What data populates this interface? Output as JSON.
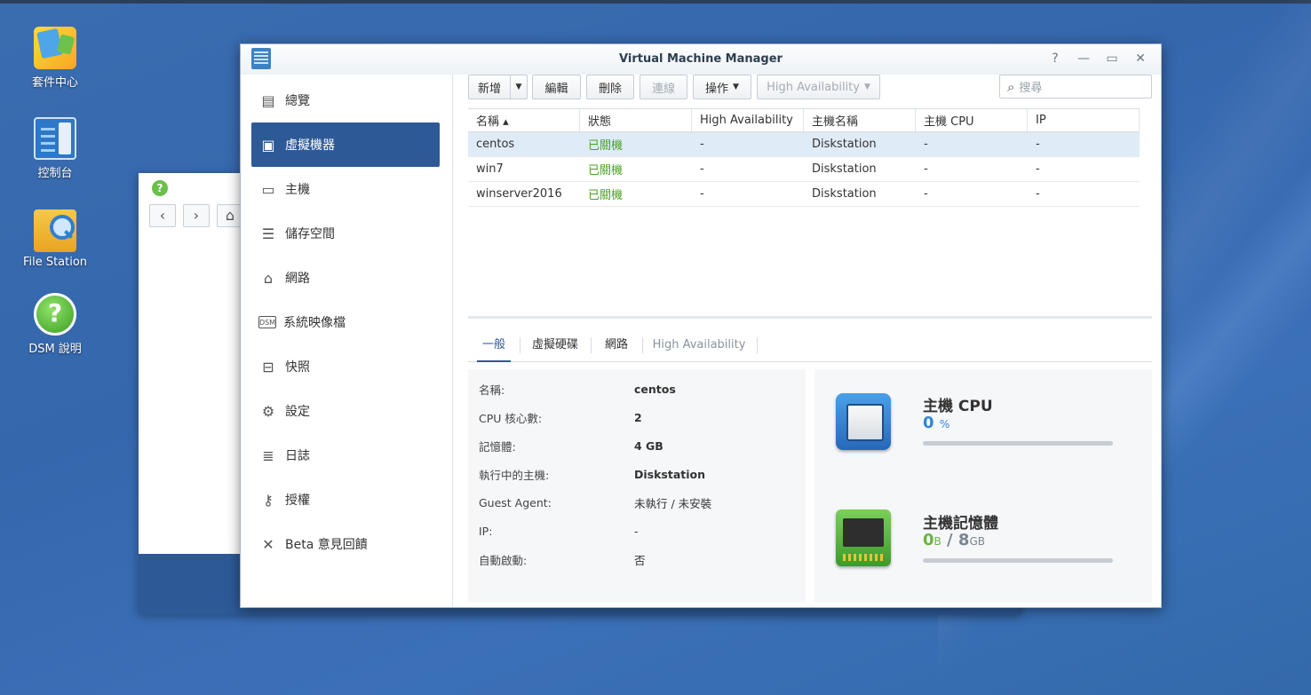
{
  "desktop": {
    "icons": [
      {
        "label": "套件中心",
        "icon": "package-center-icon"
      },
      {
        "label": "控制台",
        "icon": "control-panel-icon"
      },
      {
        "label": "File Station",
        "icon": "file-station-icon"
      },
      {
        "label": "DSM 說明",
        "icon": "dsm-help-icon"
      }
    ]
  },
  "bg_window": {
    "help_glyph": "?"
  },
  "window": {
    "title": "Virtual Machine Manager",
    "controls": {
      "help": "?",
      "minimize": "—",
      "maximize": "▭",
      "close": "✕"
    }
  },
  "sidebar": {
    "items": [
      {
        "label": "總覽",
        "icon": "overview-icon",
        "active": false
      },
      {
        "label": "虛擬機器",
        "icon": "virtual-machine-icon",
        "active": true
      },
      {
        "label": "主機",
        "icon": "host-icon",
        "active": false
      },
      {
        "label": "儲存空間",
        "icon": "storage-icon",
        "active": false
      },
      {
        "label": "網路",
        "icon": "network-icon",
        "active": false
      },
      {
        "label": "系統映像檔",
        "icon": "image-icon",
        "active": false
      },
      {
        "label": "快照",
        "icon": "snapshot-icon",
        "active": false
      },
      {
        "label": "設定",
        "icon": "settings-gear-icon",
        "active": false
      },
      {
        "label": "日誌",
        "icon": "log-icon",
        "active": false
      },
      {
        "label": "授權",
        "icon": "license-key-icon",
        "active": false
      },
      {
        "label": "Beta 意見回饋",
        "icon": "feedback-wrench-icon",
        "active": false
      }
    ]
  },
  "toolbar": {
    "create": "新增",
    "edit": "編輯",
    "delete": "刪除",
    "connect": "連線",
    "action": "操作",
    "high_availability": "High Availability",
    "search_placeholder": "搜尋"
  },
  "grid": {
    "columns": [
      "名稱 ▴",
      "狀態",
      "High Availability",
      "主機名稱",
      "主機 CPU",
      "IP"
    ],
    "rows": [
      [
        "centos",
        "已關機",
        "-",
        "Diskstation",
        "-",
        "-"
      ],
      [
        "win7",
        "已關機",
        "-",
        "Diskstation",
        "-",
        "-"
      ],
      [
        "winserver2016",
        "已關機",
        "-",
        "Diskstation",
        "-",
        "-"
      ]
    ],
    "selected_row": 0
  },
  "detail_tabs": [
    "一般",
    "虛擬硬碟",
    "網路",
    "High Availability"
  ],
  "general": [
    {
      "key": "名稱:",
      "value": "centos"
    },
    {
      "key": "CPU 核心數:",
      "value": "2"
    },
    {
      "key": "記憶體:",
      "value": "4 GB"
    },
    {
      "key": "執行中的主機:",
      "value": "Diskstation"
    },
    {
      "key": "Guest Agent:",
      "value": "未執行 / 未安裝"
    },
    {
      "key": "IP:",
      "value": "-"
    },
    {
      "key": "自動啟動:",
      "value": "否"
    }
  ],
  "meters": {
    "cpu": {
      "title": "主機 CPU",
      "value": "0",
      "unit": "%",
      "fraction": 0,
      "color": "#2f86d6"
    },
    "memory": {
      "title": "主機記憶體",
      "used": "0",
      "used_unit": "B",
      "sep": "/",
      "total": "8",
      "total_unit": "GB",
      "fraction": 0,
      "used_color": "#6cb33f",
      "total_color": "#7a8590"
    }
  }
}
